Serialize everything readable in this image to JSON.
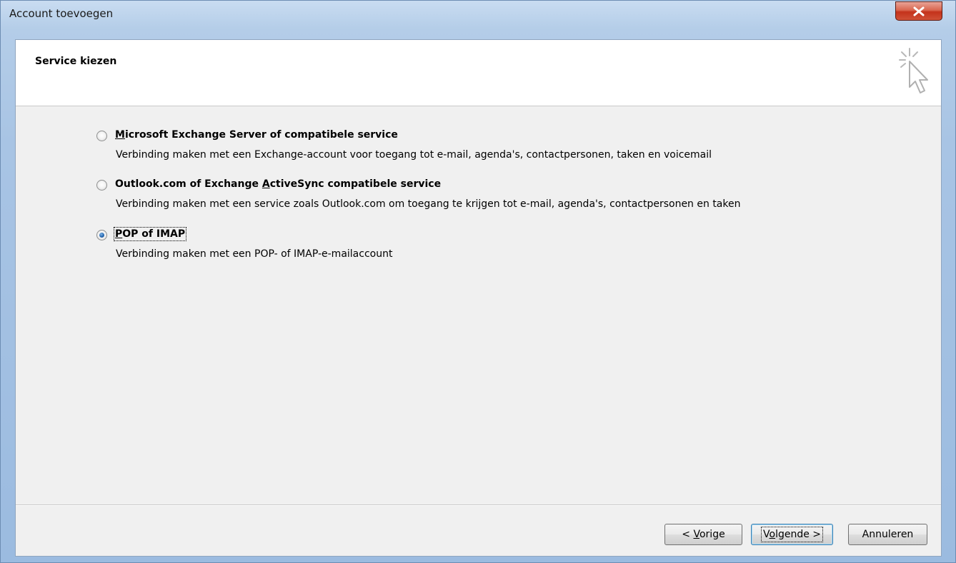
{
  "window": {
    "title": "Account toevoegen",
    "close_icon": "close-x-icon"
  },
  "header": {
    "title": "Service kiezen",
    "icon": "sparkle-cursor-icon"
  },
  "options": [
    {
      "label_accel": "M",
      "label_rest": "icrosoft Exchange Server of compatibele service",
      "description": "Verbinding maken met een Exchange-account voor toegang tot e-mail, agenda's, contactpersonen, taken en voicemail",
      "selected": false
    },
    {
      "label_pre": "Outlook.com of Exchange ",
      "label_accel": "A",
      "label_rest": "ctiveSync compatibele service",
      "description": "Verbinding maken met een service zoals Outlook.com om toegang te krijgen tot e-mail, agenda's, contactpersonen en taken",
      "selected": false
    },
    {
      "label_accel": "P",
      "label_rest": "OP of IMAP",
      "description": "Verbinding maken met een POP- of IMAP-e-mailaccount",
      "selected": true
    }
  ],
  "buttons": {
    "back_pre": "< ",
    "back_accel": "V",
    "back_rest": "orige",
    "next_pre": "V",
    "next_accel": "o",
    "next_rest": "lgende >",
    "cancel": "Annuleren"
  },
  "colors": {
    "accent": "#2769b1",
    "close_red": "#c4321b"
  }
}
